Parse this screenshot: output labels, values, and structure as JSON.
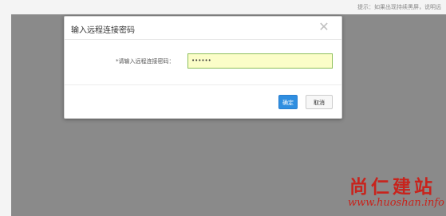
{
  "topbar": {
    "hint": "提示：如果出现持续黑屏，说明远"
  },
  "dialog": {
    "title": "输入远程连接密码",
    "close_icon": "close-icon",
    "field_label": "*请输入远程连接密码：",
    "password_value": "••••••",
    "ok_label": "确定",
    "cancel_label": "取消"
  },
  "watermark": {
    "brand": "尚仁建站",
    "url": "www.huoshan.info"
  },
  "colors": {
    "overlay": "#8a8a8a",
    "primary_button": "#2f8ee0",
    "input_bg": "#fbfdc8",
    "input_border": "#8dbf5a",
    "watermark": "#c8231c"
  }
}
